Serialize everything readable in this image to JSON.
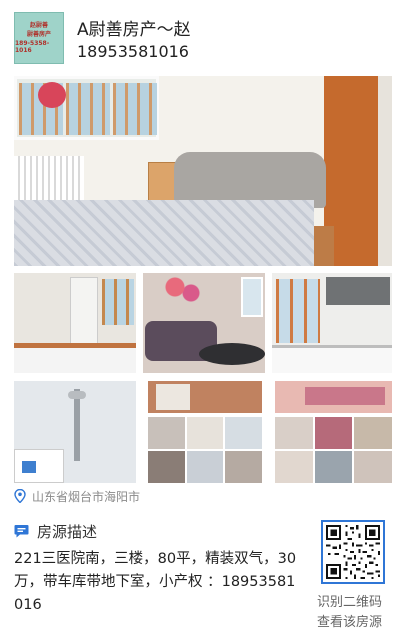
{
  "agent": {
    "logo_lines": [
      "赵尉善",
      "尉善房产",
      "189-5358-1016"
    ],
    "name": "A尉善房产～赵",
    "phone": "18953581016"
  },
  "photos": {
    "main": "bedroom-photo",
    "row2": [
      "kitchen-corner-photo",
      "living-room-photo",
      "kitchen-photo"
    ],
    "row3_left": "bathroom-photo",
    "row3_top": [
      "room-photo",
      "bedroom-photo-2"
    ],
    "thumb_colors_left": [
      "#c8c0ba",
      "#e7e2db",
      "#d6dde3",
      "#8a7d76",
      "#c9cfd6",
      "#b5aaa2"
    ],
    "thumb_colors_right": [
      "#d9cfc8",
      "#b66a7a",
      "#c7b9a9",
      "#e1d7cf",
      "#9aa4ad",
      "#cfc3bb"
    ]
  },
  "location": {
    "icon": "location-pin-icon",
    "text": "山东省烟台市海阳市"
  },
  "description": {
    "icon": "chat-bubble-icon",
    "title": "房源描述",
    "body": "221三医院南，三楼，80平，精装双气，30万，带车库带地下室，小产权 ：18953581016"
  },
  "qr": {
    "caption_line1": "识别二维码",
    "caption_line2": "查看该房源"
  },
  "colors": {
    "accent_blue": "#2f76d6",
    "logo_bg": "#9fd3c9",
    "logo_text": "#b0302a"
  }
}
